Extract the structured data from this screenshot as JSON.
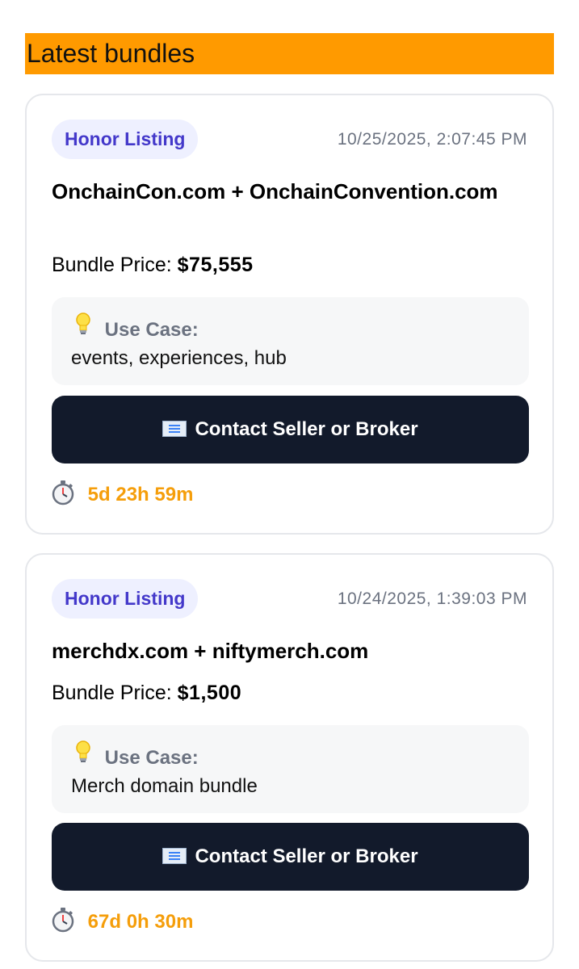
{
  "section": {
    "title": "Latest bundles"
  },
  "listings": [
    {
      "badge": "Honor Listing",
      "timestamp": "10/25/2025, 2:07:45 PM",
      "domains": "OnchainCon.com + OnchainConvention.com",
      "price_label": "Bundle Price:",
      "price_value": "$75,555",
      "use_case_title": "Use Case:",
      "use_case_text": "events, experiences, hub",
      "contact_label": "Contact Seller or Broker",
      "time_left": "5d 23h 59m"
    },
    {
      "badge": "Honor Listing",
      "timestamp": "10/24/2025, 1:39:03 PM",
      "domains": "merchdx.com + niftymerch.com",
      "price_label": "Bundle Price:",
      "price_value": "$1,500",
      "use_case_title": "Use Case:",
      "use_case_text": "Merch domain bundle",
      "contact_label": "Contact Seller or Broker",
      "time_left": "67d 0h 30m"
    }
  ],
  "icons": {
    "use_case": "lightbulb-icon",
    "contact": "envelope-icon",
    "timer": "stopwatch-icon"
  },
  "colors": {
    "header_bg": "#ff9a00",
    "badge_bg": "#eef0ff",
    "badge_text": "#4338ca",
    "button_bg": "#121a2b",
    "timer_text": "#f59e0b"
  }
}
